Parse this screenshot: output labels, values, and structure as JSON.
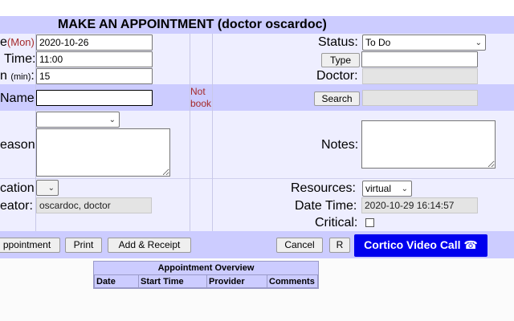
{
  "title": "MAKE AN APPOINTMENT (doctor oscardoc)",
  "date": {
    "label": "e",
    "day": "(Mon)",
    "sep": ":",
    "value": "2020-10-26"
  },
  "time": {
    "label": "Time:",
    "value": "11:00"
  },
  "duration": {
    "label": "n",
    "unit": "(min)",
    "sep": ":",
    "value": "15"
  },
  "name": {
    "label": "Name:",
    "value": "",
    "not_book": "Not book"
  },
  "reason": {
    "label": "eason:",
    "select_value": "",
    "text": ""
  },
  "location": {
    "label": "cation:",
    "select_value": ""
  },
  "creator": {
    "label": "eator:",
    "value": "oscardoc, doctor"
  },
  "status": {
    "label": "Status:",
    "value": "To Do"
  },
  "type": {
    "button": "Type",
    "value": ""
  },
  "doctor": {
    "label": "Doctor:",
    "value": ""
  },
  "search": {
    "button": "Search",
    "value": ""
  },
  "notes": {
    "label": "Notes:",
    "text": ""
  },
  "resources": {
    "label": "Resources:",
    "value": "virtual"
  },
  "datetime": {
    "label": "Date Time:",
    "value": "2020-10-29 16:14:57"
  },
  "critical": {
    "label": "Critical:",
    "checked": false
  },
  "buttons": {
    "appointment": "ppointment",
    "print": "Print",
    "add_receipt": "Add & Receipt",
    "cancel": "Cancel",
    "r": "R",
    "cortico": "Cortico Video Call ☎"
  },
  "overview": {
    "title": "Appointment Overview",
    "columns": [
      "Date",
      "Start Time",
      "Provider",
      "Comments"
    ]
  },
  "colors": {
    "band": "#ccccff",
    "row": "#eeeeff",
    "cortico": "#0000ee",
    "not_book": "#a52a2a"
  }
}
